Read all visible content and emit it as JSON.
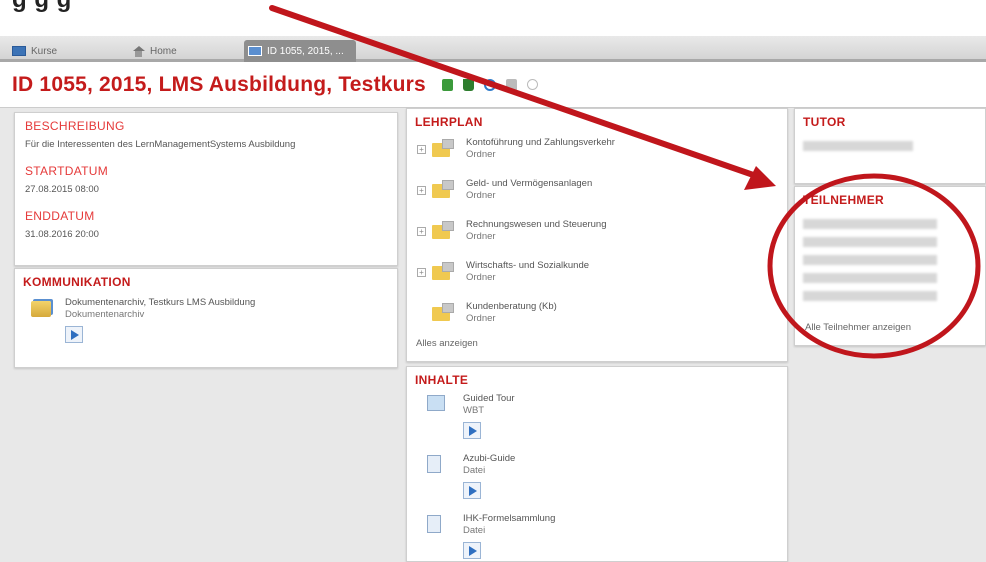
{
  "caption_top": "g                                                         g      g",
  "tabs": [
    {
      "label": "Kurse",
      "icon": "course-list-icon"
    },
    {
      "label": "Home",
      "icon": "home-icon"
    },
    {
      "label": "ID 1055, 2015, ...",
      "icon": "course-list-icon"
    }
  ],
  "page": {
    "title": "ID 1055, 2015, LMS Ausbildung, Testkurs",
    "title_icons": [
      "export-icon",
      "download-icon",
      "refresh-icon",
      "lock-icon",
      "info-icon"
    ]
  },
  "info": {
    "beschreibung_head": "BESCHREIBUNG",
    "beschreibung": "Für die Interessenten des LernManagementSystems Ausbildung",
    "startdatum_head": "STARTDATUM",
    "startdatum": "27.08.2015 08:00",
    "enddatum_head": "ENDDATUM",
    "enddatum": "31.08.2016 20:00"
  },
  "kommunikation": {
    "head": "KOMMUNIKATION",
    "item_name": "Dokumentenarchiv, Testkurs LMS Ausbildung",
    "item_type": "Dokumentenarchiv"
  },
  "lehrplan": {
    "head": "LEHRPLAN",
    "items": [
      {
        "name": "Kontoführung und Zahlungsverkehr",
        "type": "Ordner"
      },
      {
        "name": "Geld- und Vermögensanlagen",
        "type": "Ordner"
      },
      {
        "name": "Rechnungswesen und Steuerung",
        "type": "Ordner"
      },
      {
        "name": "Wirtschafts- und Sozialkunde",
        "type": "Ordner"
      },
      {
        "name": "Kundenberatung (Kb)",
        "type": "Ordner"
      }
    ],
    "show_all": "Alles anzeigen"
  },
  "inhalte": {
    "head": "INHALTE",
    "items": [
      {
        "name": "Guided Tour",
        "type": "WBT"
      },
      {
        "name": "Azubi-Guide",
        "type": "Datei"
      },
      {
        "name": "IHK-Formelsammlung",
        "type": "Datei"
      }
    ]
  },
  "tutor": {
    "head": "TUTOR"
  },
  "teilnehmer": {
    "head": "TEILNEHMER",
    "show_all": "Alle Teilnehmer anzeigen"
  },
  "colors": {
    "title_red": "#c41b1b",
    "annotation_red": "#c0161c"
  }
}
